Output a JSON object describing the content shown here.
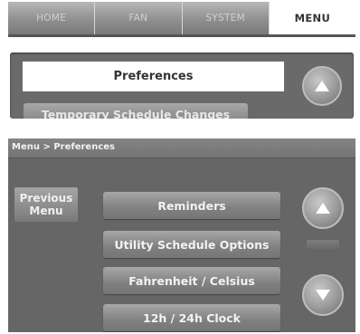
{
  "tabs": [
    {
      "label": "HOME",
      "active": false
    },
    {
      "label": "FAN",
      "active": false
    },
    {
      "label": "SYSTEM",
      "active": false
    },
    {
      "label": "MENU",
      "active": true
    }
  ],
  "menu_list": {
    "highlighted_item": "Preferences",
    "next_item": "Temporary Schedule Changes",
    "scroll_up_icon": "up-arrow-icon"
  },
  "preferences_screen": {
    "breadcrumb": "Menu > Preferences",
    "previous_menu": {
      "line1": "Previous",
      "line2": "Menu"
    },
    "items": [
      "Reminders",
      "Utility Schedule Options",
      "Fahrenheit / Celsius",
      "12h / 24h Clock"
    ],
    "scroll_up_icon": "up-arrow-icon",
    "scroll_down_icon": "down-arrow-icon"
  },
  "colors": {
    "panel_bg": "#666666",
    "button_gradient_top": "#a7a7a7",
    "button_gradient_bottom": "#767676",
    "highlight": "#ffffff"
  }
}
